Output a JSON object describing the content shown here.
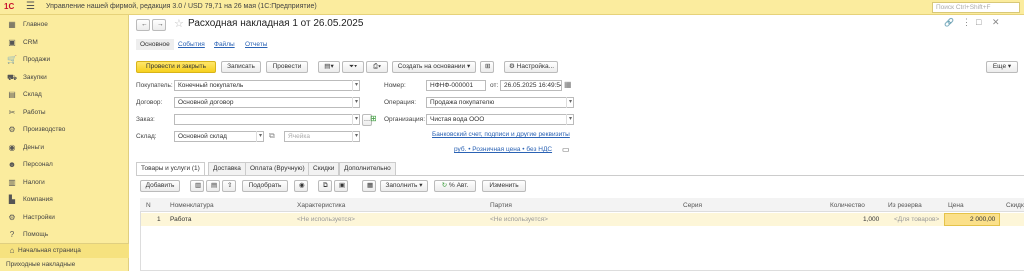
{
  "app": {
    "logo": "1С",
    "title": "Управление нашей фирмой, редакция 3.0 / USD 79,71 на 26 мая  (1С:Предприятие)",
    "search_placeholder": "Поиск Ctrl+Shift+F"
  },
  "sidebar": {
    "items": [
      {
        "label": "Главное",
        "icon": "home-grid-icon",
        "glyph": "▦"
      },
      {
        "label": "CRM",
        "icon": "crm-icon",
        "glyph": "▣"
      },
      {
        "label": "Продажи",
        "icon": "cart-icon",
        "glyph": "🛒"
      },
      {
        "label": "Закупки",
        "icon": "truck-icon",
        "glyph": "⛟"
      },
      {
        "label": "Склад",
        "icon": "warehouse-icon",
        "glyph": "▤"
      },
      {
        "label": "Работы",
        "icon": "tools-icon",
        "glyph": "✂"
      },
      {
        "label": "Производство",
        "icon": "gear-icon",
        "glyph": "⚙"
      },
      {
        "label": "Деньги",
        "icon": "money-icon",
        "glyph": "◉"
      },
      {
        "label": "Персонал",
        "icon": "person-icon",
        "glyph": "☻"
      },
      {
        "label": "Налоги",
        "icon": "tax-icon",
        "glyph": "▥"
      },
      {
        "label": "Компания",
        "icon": "building-icon",
        "glyph": "▙"
      },
      {
        "label": "Настройки",
        "icon": "settings-icon",
        "glyph": "⚙"
      },
      {
        "label": "Помощь",
        "icon": "help-icon",
        "glyph": "?"
      }
    ],
    "bottom": [
      {
        "label": "Начальная страница",
        "icon": "house-icon",
        "glyph": "⌂"
      },
      {
        "label": "Приходные накладные",
        "icon": "",
        "glyph": ""
      }
    ]
  },
  "document": {
    "title": "Расходная накладная 1 от 26.05.2025",
    "subtabs": [
      "Основное",
      "События",
      "Файлы",
      "Отчеты"
    ],
    "toolbar": {
      "post_close": "Провести и закрыть",
      "save": "Записать",
      "post": "Провести",
      "create_based": "Создать на основании",
      "settings": "Настройка..."
    }
  },
  "form": {
    "buyer_label": "Покупатель:",
    "buyer_value": "Конечный покупатель",
    "contract_label": "Договор:",
    "contract_value": "Основной договор",
    "order_label": "Заказ:",
    "warehouse_label": "Склад:",
    "warehouse_value": "Основной склад",
    "cell_placeholder": "Ячейка",
    "number_label": "Номер:",
    "number_value": "НФНФ-000001",
    "date_from": "от:",
    "date_value": "26.05.2025 16:49:54",
    "operation_label": "Операция:",
    "operation_value": "Продажа покупателю",
    "org_label": "Организация:",
    "org_value": "Чистая вода ООО",
    "bank_link": "Банковский счет, подписи и другие реквизиты",
    "price_link": "руб. • Розничная цена • без НДС"
  },
  "tabs": [
    "Товары и услуги (1)",
    "Доставка",
    "Оплата (Вручную)",
    "Скидки",
    "Дополнительно"
  ],
  "table_toolbar": {
    "add": "Добавить",
    "select": "Подобрать",
    "fill": "Заполнить",
    "percent": "% Авт.",
    "change": "Изменить"
  },
  "table": {
    "headers": [
      "N",
      "Номенклатура",
      "Характеристика",
      "Партия",
      "Серия",
      "Количество",
      "Из резерва",
      "Цена",
      "Скидк"
    ],
    "rows": [
      {
        "n": "1",
        "item": "Работа",
        "characteristic": "<Не используется>",
        "batch": "<Не используется>",
        "series": "",
        "qty": "1,000",
        "reserve": "<Для товаров>",
        "price": "2 000,00",
        "discount": ""
      }
    ]
  },
  "colors": {
    "sidebar_bg": "#fbec9e",
    "primary_button": "#f7d11e",
    "link": "#2a62b4",
    "selected_row": "#fdf6d8"
  }
}
